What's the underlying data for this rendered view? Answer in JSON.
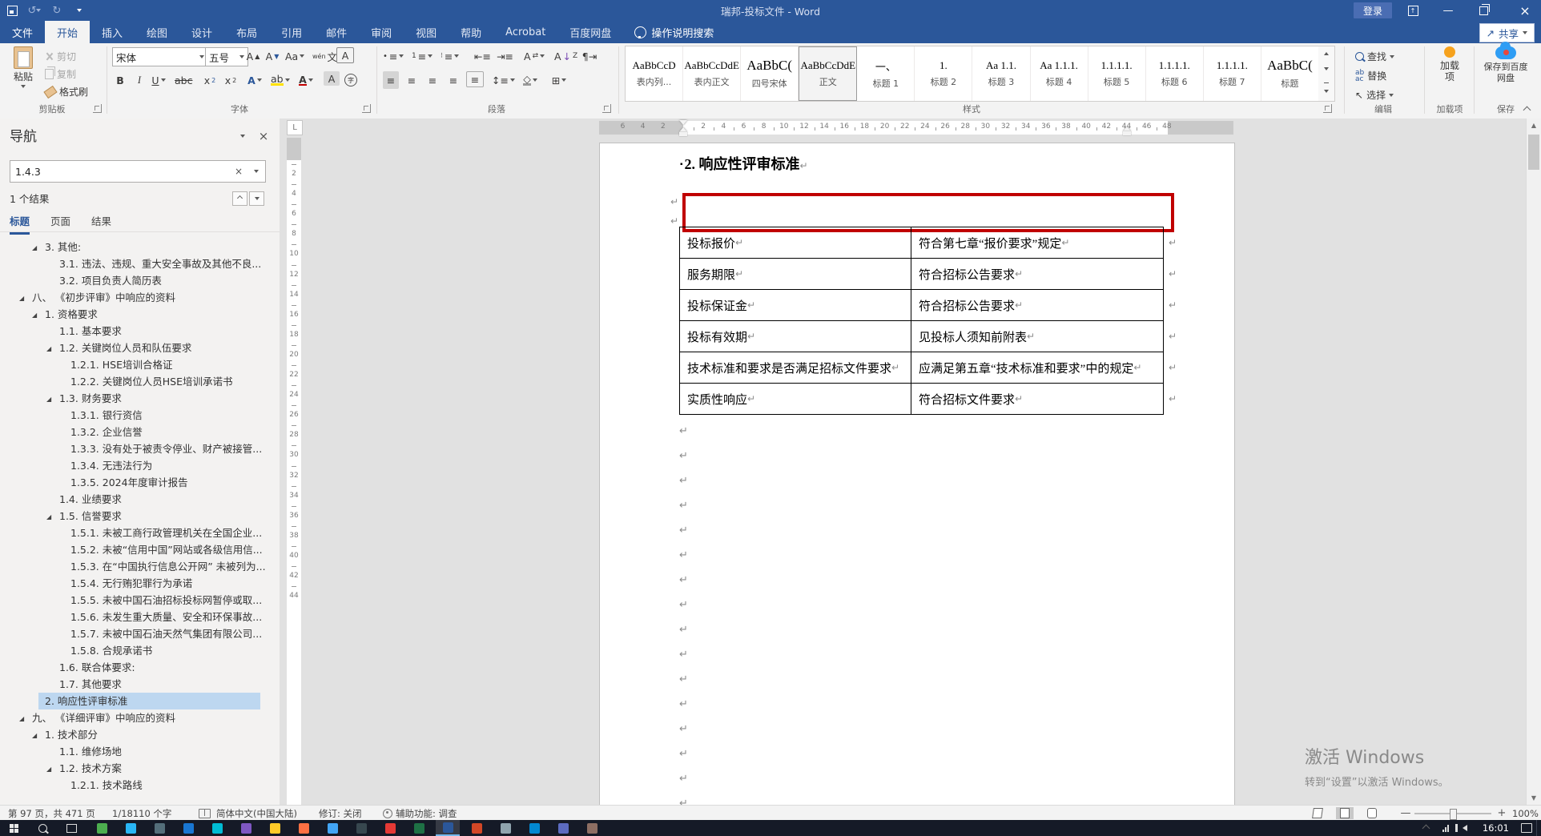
{
  "title_bar": {
    "title": "瑞邦-投标文件  -  Word",
    "sign_in": "登录",
    "share": "共享",
    "minimize_glyph": "—",
    "close_glyph": "×"
  },
  "ribbon_tabs": {
    "file": "文件",
    "items": [
      "开始",
      "插入",
      "绘图",
      "设计",
      "布局",
      "引用",
      "邮件",
      "审阅",
      "视图",
      "帮助",
      "Acrobat",
      "百度网盘"
    ],
    "selected": "开始",
    "tell_me": "操作说明搜索"
  },
  "ribbon": {
    "clipboard": {
      "paste": "粘贴",
      "cut": "剪切",
      "copy": "复制",
      "format_painter": "格式刷",
      "label": "剪贴板"
    },
    "font": {
      "name": "宋体",
      "size": "五号",
      "label": "字体"
    },
    "paragraph": {
      "label": "段落"
    },
    "styles": {
      "label": "样式",
      "items": [
        {
          "preview": "AaBbCcD",
          "label": "表内列...",
          "big": false,
          "selected": false
        },
        {
          "preview": "AaBbCcDdE",
          "label": "表内正文",
          "big": false,
          "selected": false
        },
        {
          "preview": "AaBbC(",
          "label": "四号宋体",
          "big": true,
          "selected": false
        },
        {
          "preview": "AaBbCcDdE",
          "label": "正文",
          "big": false,
          "selected": true
        },
        {
          "preview": "一、",
          "label": "标题 1",
          "big": false,
          "selected": false
        },
        {
          "preview": "1.",
          "label": "标题 2",
          "big": false,
          "selected": false
        },
        {
          "preview": "Aa 1.1.",
          "label": "标题 3",
          "big": false,
          "selected": false
        },
        {
          "preview": "Aa 1.1.1.",
          "label": "标题 4",
          "big": false,
          "selected": false
        },
        {
          "preview": "1.1.1.1.",
          "label": "标题 5",
          "big": false,
          "selected": false
        },
        {
          "preview": "1.1.1.1.",
          "label": "标题 6",
          "big": false,
          "selected": false
        },
        {
          "preview": "1.1.1.1.",
          "label": "标题 7",
          "big": false,
          "selected": false
        },
        {
          "preview": "AaBbC(",
          "label": "标题",
          "big": true,
          "selected": false
        }
      ]
    },
    "editing": {
      "find": "查找",
      "replace": "替换",
      "select": "选择",
      "label": "编辑"
    },
    "addins": {
      "button": "加载项",
      "label": "加载项"
    },
    "baidu": {
      "button": "保存到百度网盘",
      "label": "保存"
    }
  },
  "nav": {
    "title": "导航",
    "search_value": "1.4.3",
    "result_count": "1 个结果",
    "tabs": [
      "标题",
      "页面",
      "结果"
    ],
    "active_tab": "标题",
    "items": [
      {
        "level": 2,
        "expanded": true,
        "selected": false,
        "text": "3. 其他:"
      },
      {
        "level": 3,
        "expanded": false,
        "selected": false,
        "text": "3.1. 违法、违规、重大安全事故及其他不良..."
      },
      {
        "level": 3,
        "expanded": false,
        "selected": false,
        "text": "3.2. 项目负责人简历表"
      },
      {
        "level": 1,
        "expanded": true,
        "selected": false,
        "text": "八、 《初步评审》中响应的资料"
      },
      {
        "level": 2,
        "expanded": true,
        "selected": false,
        "text": "1. 资格要求"
      },
      {
        "level": 3,
        "expanded": false,
        "selected": false,
        "text": "1.1. 基本要求"
      },
      {
        "level": 3,
        "expanded": true,
        "selected": false,
        "text": "1.2. 关键岗位人员和队伍要求"
      },
      {
        "level": 4,
        "expanded": false,
        "selected": false,
        "text": "1.2.1. HSE培训合格证"
      },
      {
        "level": 4,
        "expanded": false,
        "selected": false,
        "text": "1.2.2. 关键岗位人员HSE培训承诺书"
      },
      {
        "level": 3,
        "expanded": true,
        "selected": false,
        "text": "1.3. 财务要求"
      },
      {
        "level": 4,
        "expanded": false,
        "selected": false,
        "text": "1.3.1. 银行资信"
      },
      {
        "level": 4,
        "expanded": false,
        "selected": false,
        "text": "1.3.2. 企业信誉"
      },
      {
        "level": 4,
        "expanded": false,
        "selected": false,
        "text": "1.3.3. 没有处于被责令停业、财产被接管..."
      },
      {
        "level": 4,
        "expanded": false,
        "selected": false,
        "text": "1.3.4. 无违法行为"
      },
      {
        "level": 4,
        "expanded": false,
        "selected": false,
        "text": "1.3.5. 2024年度审计报告"
      },
      {
        "level": 3,
        "expanded": false,
        "selected": false,
        "text": "1.4. 业绩要求"
      },
      {
        "level": 3,
        "expanded": true,
        "selected": false,
        "text": "1.5. 信誉要求"
      },
      {
        "level": 4,
        "expanded": false,
        "selected": false,
        "text": "1.5.1. 未被工商行政管理机关在全国企业..."
      },
      {
        "level": 4,
        "expanded": false,
        "selected": false,
        "text": "1.5.2. 未被“信用中国”网站或各级信用信..."
      },
      {
        "level": 4,
        "expanded": false,
        "selected": false,
        "text": "1.5.3. 在“中国执行信息公开网” 未被列为..."
      },
      {
        "level": 4,
        "expanded": false,
        "selected": false,
        "text": "1.5.4. 无行贿犯罪行为承诺"
      },
      {
        "level": 4,
        "expanded": false,
        "selected": false,
        "text": "1.5.5. 未被中国石油招标投标网暂停或取..."
      },
      {
        "level": 4,
        "expanded": false,
        "selected": false,
        "text": "1.5.6. 未发生重大质量、安全和环保事故..."
      },
      {
        "level": 4,
        "expanded": false,
        "selected": false,
        "text": "1.5.7. 未被中国石油天然气集团有限公司..."
      },
      {
        "level": 4,
        "expanded": false,
        "selected": false,
        "text": "1.5.8. 合规承诺书"
      },
      {
        "level": 3,
        "expanded": false,
        "selected": false,
        "text": "1.6. 联合体要求:"
      },
      {
        "level": 3,
        "expanded": false,
        "selected": false,
        "text": "1.7. 其他要求"
      },
      {
        "level": 2,
        "expanded": false,
        "selected": true,
        "text": "2. 响应性评审标准"
      },
      {
        "level": 1,
        "expanded": true,
        "selected": false,
        "text": "九、 《详细评审》中响应的资料"
      },
      {
        "level": 2,
        "expanded": true,
        "selected": false,
        "text": "1. 技术部分"
      },
      {
        "level": 3,
        "expanded": false,
        "selected": false,
        "text": "1.1. 维修场地"
      },
      {
        "level": 3,
        "expanded": true,
        "selected": false,
        "text": "1.2. 技术方案"
      },
      {
        "level": 4,
        "expanded": false,
        "selected": false,
        "text": "1.2.1. 技术路线"
      }
    ]
  },
  "ruler": {
    "left_numbers": [
      "6",
      "4",
      "2"
    ],
    "main_numbers": [
      "2",
      "4",
      "6",
      "8",
      "10",
      "12",
      "14",
      "16",
      "18",
      "20",
      "22",
      "24",
      "26",
      "28",
      "30",
      "32",
      "34",
      "36",
      "38",
      "40",
      "42",
      "44",
      "46",
      "48"
    ],
    "vertical_numbers": [
      "2",
      "4",
      "6",
      "8",
      "10",
      "12",
      "14",
      "16",
      "18",
      "20",
      "22",
      "24",
      "26",
      "28",
      "30",
      "32",
      "34",
      "36",
      "38",
      "40",
      "42",
      "44"
    ]
  },
  "document": {
    "heading_bullet": "▪",
    "heading": "2. 响应性评审标准",
    "mark": "↵",
    "table": {
      "rows": [
        [
          "投标报价",
          "符合第七章“报价要求”规定"
        ],
        [
          "服务期限",
          "符合招标公告要求"
        ],
        [
          "投标保证金",
          "符合招标公告要求"
        ],
        [
          "投标有效期",
          "见投标人须知前附表"
        ],
        [
          "技术标准和要求是否满足招标文件要求",
          "应满足第五章“技术标准和要求”中的规定"
        ],
        [
          "实质性响应",
          "符合招标文件要求"
        ]
      ]
    },
    "empty_paragraphs": 16
  },
  "watermark": {
    "line1": "激活 Windows",
    "line2": "转到“设置”以激活 Windows。"
  },
  "status_bar": {
    "page_info": "第 97 页，共 471 页",
    "word_count": "1/18110 个字",
    "language": "简体中文(中国大陆)",
    "track_changes": "修订: 关闭",
    "accessibility": "辅助功能: 调查",
    "zoom_level": "100%"
  },
  "taskbar": {
    "time": "16:01",
    "apps": [
      {
        "color": "#4cae4f",
        "active": false
      },
      {
        "color": "#29b6f6",
        "active": false
      },
      {
        "color": "#546e7a",
        "active": false
      },
      {
        "color": "#1976d2",
        "active": false
      },
      {
        "color": "#00bcd4",
        "active": false
      },
      {
        "color": "#7e57c2",
        "active": false
      },
      {
        "color": "#ffca28",
        "active": false
      },
      {
        "color": "#ff7043",
        "active": false
      },
      {
        "color": "#42a5f5",
        "active": false
      },
      {
        "color": "#37474f",
        "active": false
      },
      {
        "color": "#e53935",
        "active": false
      },
      {
        "color": "#1e7145",
        "active": false
      },
      {
        "color": "#2b579a",
        "active": true
      },
      {
        "color": "#d24726",
        "active": false
      },
      {
        "color": "#90a4ae",
        "active": false
      },
      {
        "color": "#0288d1",
        "active": false
      },
      {
        "color": "#5c6bc0",
        "active": false
      },
      {
        "color": "#8d6e63",
        "active": false
      }
    ]
  }
}
